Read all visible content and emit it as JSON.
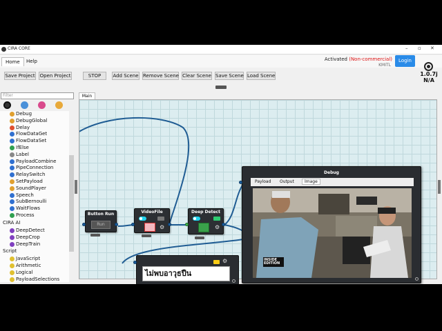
{
  "window": {
    "title": "CIRA CORE",
    "controls": [
      "–",
      "▫",
      "✕"
    ]
  },
  "menu": {
    "tabs": [
      "Home",
      "Help"
    ],
    "active": 0
  },
  "license": {
    "prefix": "Activated ",
    "type": "(Non-commercial)",
    "org": "KMITL"
  },
  "login_label": "Login",
  "version": {
    "number": "1.0.7j",
    "sub": "N/A"
  },
  "toolbar": {
    "buttons": [
      "Save Project",
      "Open Project",
      "STOP",
      "Add Scene",
      "Remove Scene",
      "Clear Scene",
      "Save Scene",
      "Load Scene"
    ]
  },
  "filter": {
    "placeholder": "Filter"
  },
  "node_list": {
    "items_a": [
      "Debug",
      "DebugGlobal",
      "Delay",
      "FlowDataGet",
      "FlowDataSet",
      "IfElse",
      "Label",
      "PayloadCombine",
      "PipeConnection",
      "RelaySwitch",
      "SetPayload",
      "SoundPlayer",
      "Speech",
      "SubBernoulli",
      "WaitFlows",
      "Process"
    ],
    "section_ai": "CIRA AI",
    "items_ai": [
      "DeepDetect",
      "DeepCrop",
      "DeepTrain"
    ],
    "section_script": "Script",
    "items_script": [
      "JavaScript",
      "Arithmetic",
      "Logical",
      "PayloadSelections"
    ]
  },
  "canvas": {
    "tab": "Main"
  },
  "nodes": {
    "button_run": {
      "title": "Button Run",
      "btn": "Run"
    },
    "videofile": {
      "title": "VideoFile"
    },
    "deep_detect": {
      "title": "Deep Detect"
    }
  },
  "debug": {
    "title": "Debug",
    "tabs": [
      "Payload",
      "Output",
      "Image"
    ],
    "active_tab": 2,
    "watermark": "INSIDE EDITION"
  },
  "result": {
    "text": "ไม่พบอาวุธปืน"
  },
  "colors": {
    "accent": "#2a8be8",
    "wire": "#1f5c93",
    "node": "#2c2f33",
    "toggle": "#22d3ee",
    "license_red": "#d11111"
  },
  "icons": {
    "brand": "cira-logo-icon",
    "gear": "gear-icon"
  }
}
